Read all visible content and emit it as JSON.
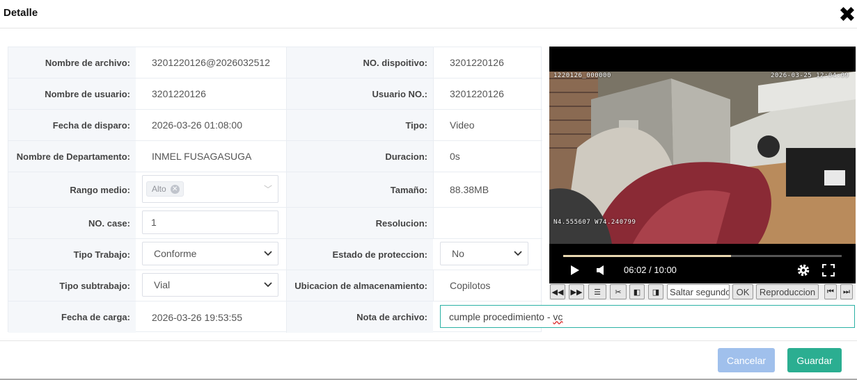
{
  "dialog": {
    "title": "Detalle"
  },
  "rows": [
    {
      "label1": "Nombre de archivo:",
      "value1": "3201220126@2026032512",
      "label2": "NO. dispoitivo:",
      "value2": "3201220126"
    },
    {
      "label1": "Nombre de usuario:",
      "value1": "3201220126",
      "label2": "Usuario NO.:",
      "value2": "3201220126"
    },
    {
      "label1": "Fecha de disparo:",
      "value1": "2026-03-26 01:08:00",
      "label2": "Tipo:",
      "value2": "Video"
    },
    {
      "label1": "Nombre de Departamento:",
      "value1": "INMEL FUSAGASUGA",
      "label2": "Duracion:",
      "value2": "0s"
    },
    {
      "label1": "Rango medio:",
      "value1": "",
      "label2": "Tamaño:",
      "value2": "88.38MB"
    },
    {
      "label1": "NO. case:",
      "value1": "",
      "label2": "Resolucion:",
      "value2": ""
    },
    {
      "label1": "Tipo Trabajo:",
      "value1": "",
      "label2": "Estado de proteccion:",
      "value2": ""
    },
    {
      "label1": "Tipo subtrabajo:",
      "value1": "",
      "label2": "Ubicacion de almacenamiento:",
      "value2": "Copilotos"
    },
    {
      "label1": "Fecha de carga:",
      "value1": "2026-03-26 19:53:55",
      "label2": "Nota de archivo:",
      "value2": ""
    }
  ],
  "controls": {
    "rango_tag": "Alto",
    "case_no": "1",
    "tipo_trabajo": "Conforme",
    "estado_proteccion": "No",
    "tipo_subtrabajo": "Vial",
    "nota_archivo": "cumple procedimiento - vc",
    "nota_plain": "cumple procedimiento - ",
    "nota_misspelled": "vc"
  },
  "video": {
    "overlay_device": "1220126_000000",
    "overlay_datetime": "2026-03-25  12:04:09",
    "overlay_gps": "N4.555607  W74.240799",
    "time_display": "06:02 / 10:00",
    "progress_fraction": 0.603
  },
  "toolbar": {
    "skip_placeholder": "Saltar segundo",
    "ok_label": "OK",
    "playback_label": "Reproduccion"
  },
  "footer": {
    "cancel_label": "Cancelar",
    "save_label": "Guardar"
  },
  "colors": {
    "accent": "#2bae91",
    "cancel": "#a0c0ec",
    "label_bg": "#f5f7fa"
  },
  "icons": [
    "close-icon",
    "chevron-down-icon",
    "play-icon",
    "volume-icon",
    "gear-icon",
    "fullscreen-icon",
    "rewind-icon",
    "fast-forward-icon",
    "list-icon",
    "scissors-icon",
    "frame-back-icon",
    "frame-forward-icon",
    "skip-start-icon",
    "skip-end-icon"
  ]
}
